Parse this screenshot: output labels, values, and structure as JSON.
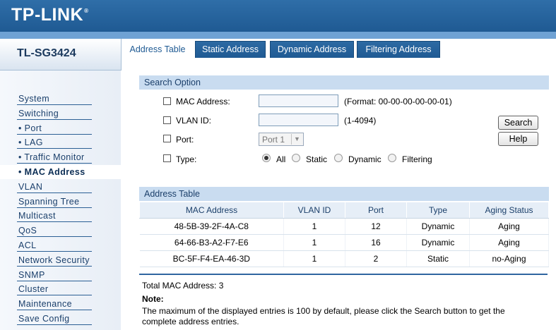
{
  "brand": {
    "logo": "TP-LINK",
    "trademark": "®",
    "model": "TL-SG3424"
  },
  "tabs": [
    {
      "label": "Address Table",
      "active": true
    },
    {
      "label": "Static Address",
      "active": false
    },
    {
      "label": "Dynamic Address",
      "active": false
    },
    {
      "label": "Filtering Address",
      "active": false
    }
  ],
  "sidebar": {
    "items": [
      {
        "label": "System"
      },
      {
        "label": "Switching"
      },
      {
        "label": "• Port"
      },
      {
        "label": "• LAG"
      },
      {
        "label": "• Traffic Monitor"
      },
      {
        "label": "• MAC Address",
        "active": true
      },
      {
        "label": "VLAN"
      },
      {
        "label": "Spanning Tree"
      },
      {
        "label": "Multicast"
      },
      {
        "label": "QoS"
      },
      {
        "label": "ACL"
      },
      {
        "label": "Network Security"
      },
      {
        "label": "SNMP"
      },
      {
        "label": "Cluster"
      },
      {
        "label": "Maintenance"
      },
      {
        "label": "Save Config"
      }
    ]
  },
  "search": {
    "title": "Search Option",
    "mac_label": "MAC Address:",
    "mac_value": "",
    "mac_hint": "(Format: 00-00-00-00-00-01)",
    "vlan_label": "VLAN ID:",
    "vlan_value": "",
    "vlan_hint": "(1-4094)",
    "port_label": "Port:",
    "port_value": "Port 1",
    "type_label": "Type:",
    "type_options": [
      "All",
      "Static",
      "Dynamic",
      "Filtering"
    ],
    "type_selected": "All",
    "search_button": "Search",
    "help_button": "Help"
  },
  "address_table": {
    "title": "Address Table",
    "columns": [
      "MAC Address",
      "VLAN ID",
      "Port",
      "Type",
      "Aging Status"
    ],
    "rows": [
      [
        "48-5B-39-2F-4A-C8",
        "1",
        "12",
        "Dynamic",
        "Aging"
      ],
      [
        "64-66-B3-A2-F7-E6",
        "1",
        "16",
        "Dynamic",
        "Aging"
      ],
      [
        "BC-5F-F4-EA-46-3D",
        "1",
        "2",
        "Static",
        "no-Aging"
      ]
    ]
  },
  "footer": {
    "total": "Total MAC Address: 3",
    "note_title": "Note:",
    "note_text": "The maximum of the displayed entries is 100 by default, please click the Search button to get the complete address entries."
  },
  "colors": {
    "header_blue": "#1f5a93",
    "section_blue": "#c9dcf0",
    "divider_blue": "#2f66a0"
  }
}
